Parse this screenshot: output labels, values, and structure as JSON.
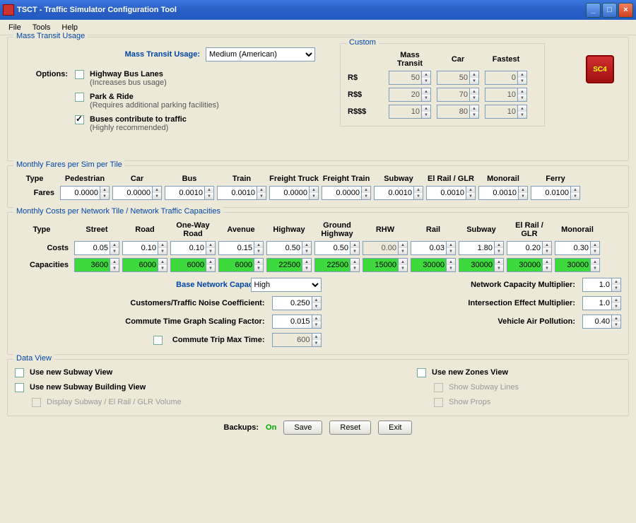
{
  "window": {
    "title": "TSCT - Traffic Simulator Configuration Tool"
  },
  "menubar": [
    "File",
    "Tools",
    "Help"
  ],
  "mtu": {
    "group_title": "Mass Transit Usage",
    "label": "Mass Transit Usage:",
    "selected": "Medium (American)",
    "options_label": "Options:",
    "opt1": "Highway Bus Lanes",
    "opt1_sub": "(Increases bus usage)",
    "opt2": "Park & Ride",
    "opt2_sub": "(Requires additional parking facilities)",
    "opt3": "Buses contribute to traffic",
    "opt3_sub": "(Highly recommended)"
  },
  "custom": {
    "title": "Custom",
    "hdr1": "Mass Transit",
    "hdr2": "Car",
    "hdr3": "Fastest",
    "r1": "R$",
    "r2": "R$$",
    "r3": "R$$$",
    "r1v": [
      "50",
      "50",
      "0"
    ],
    "r2v": [
      "20",
      "70",
      "10"
    ],
    "r3v": [
      "10",
      "80",
      "10"
    ]
  },
  "logo": "SC4",
  "fares": {
    "title": "Monthly Fares per Sim per Tile",
    "type_hdr": "Type",
    "fares_label": "Fares",
    "cols": [
      "Pedestrian",
      "Car",
      "Bus",
      "Train",
      "Freight Truck",
      "Freight Train",
      "Subway",
      "El Rail / GLR",
      "Monorail",
      "Ferry"
    ],
    "vals": [
      "0.0000",
      "0.0000",
      "0.0010",
      "0.0010",
      "0.0000",
      "0.0000",
      "0.0010",
      "0.0010",
      "0.0010",
      "0.0100"
    ]
  },
  "costs": {
    "title": "Monthly Costs per Network Tile / Network Traffic Capacities",
    "type_hdr": "Type",
    "costs_label": "Costs",
    "caps_label": "Capacities",
    "cols": [
      "Street",
      "Road",
      "One-Way Road",
      "Avenue",
      "Highway",
      "Ground Highway",
      "RHW",
      "Rail",
      "Subway",
      "El Rail / GLR",
      "Monorail"
    ],
    "cost_vals": [
      "0.05",
      "0.10",
      "0.10",
      "0.15",
      "0.50",
      "0.50",
      "0.00",
      "0.03",
      "1.80",
      "0.20",
      "0.30"
    ],
    "cap_vals": [
      "3600",
      "6000",
      "6000",
      "6000",
      "22500",
      "22500",
      "15000",
      "30000",
      "30000",
      "30000",
      "30000"
    ],
    "cost_disabled_idx": 6
  },
  "bnc": {
    "label": "Base Network Capacity:",
    "selected": "High",
    "ctn_label": "Customers/Traffic Noise Coefficient:",
    "ctn_val": "0.250",
    "ctg_label": "Commute Time Graph Scaling Factor:",
    "ctg_val": "0.015",
    "ctm_label": "Commute Trip Max Time:",
    "ctm_val": "600",
    "ncm_label": "Network Capacity Multiplier:",
    "ncm_val": "1.0",
    "iem_label": "Intersection Effect Multiplier:",
    "iem_val": "1.0",
    "vap_label": "Vehicle Air Pollution:",
    "vap_val": "0.40"
  },
  "dataview": {
    "title": "Data View",
    "o1": "Use new Subway View",
    "o2": "Use new Subway Building View",
    "o3": "Display Subway / El Rail / GLR Volume",
    "o4": "Use new Zones View",
    "o5": "Show Subway Lines",
    "o6": "Show Props"
  },
  "buttons": {
    "backups_label": "Backups:",
    "backups_state": "On",
    "save": "Save",
    "reset": "Reset",
    "exit": "Exit"
  }
}
